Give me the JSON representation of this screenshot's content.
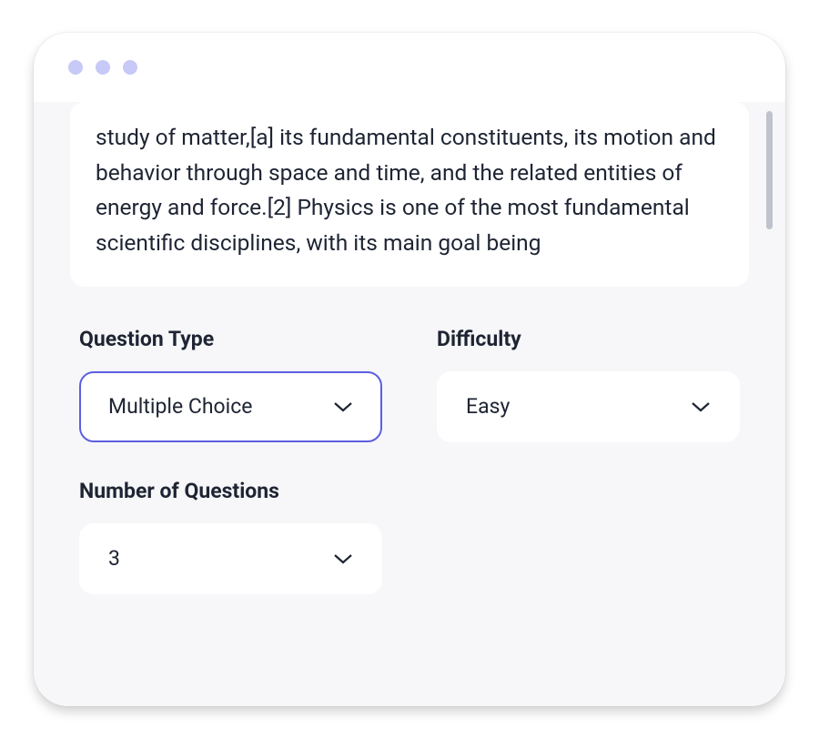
{
  "textblock": {
    "content": "study of matter,[a] its fundamental constituents, its motion and behavior through  space and time, and the related entities of energy and force.[2] Physics is one of the most fundamental scientific disciplines, with its main goal being"
  },
  "fields": {
    "question_type": {
      "label": "Question Type",
      "value": "Multiple Choice"
    },
    "difficulty": {
      "label": "Difficulty",
      "value": "Easy"
    },
    "num_questions": {
      "label": "Number of Questions",
      "value": "3"
    }
  }
}
